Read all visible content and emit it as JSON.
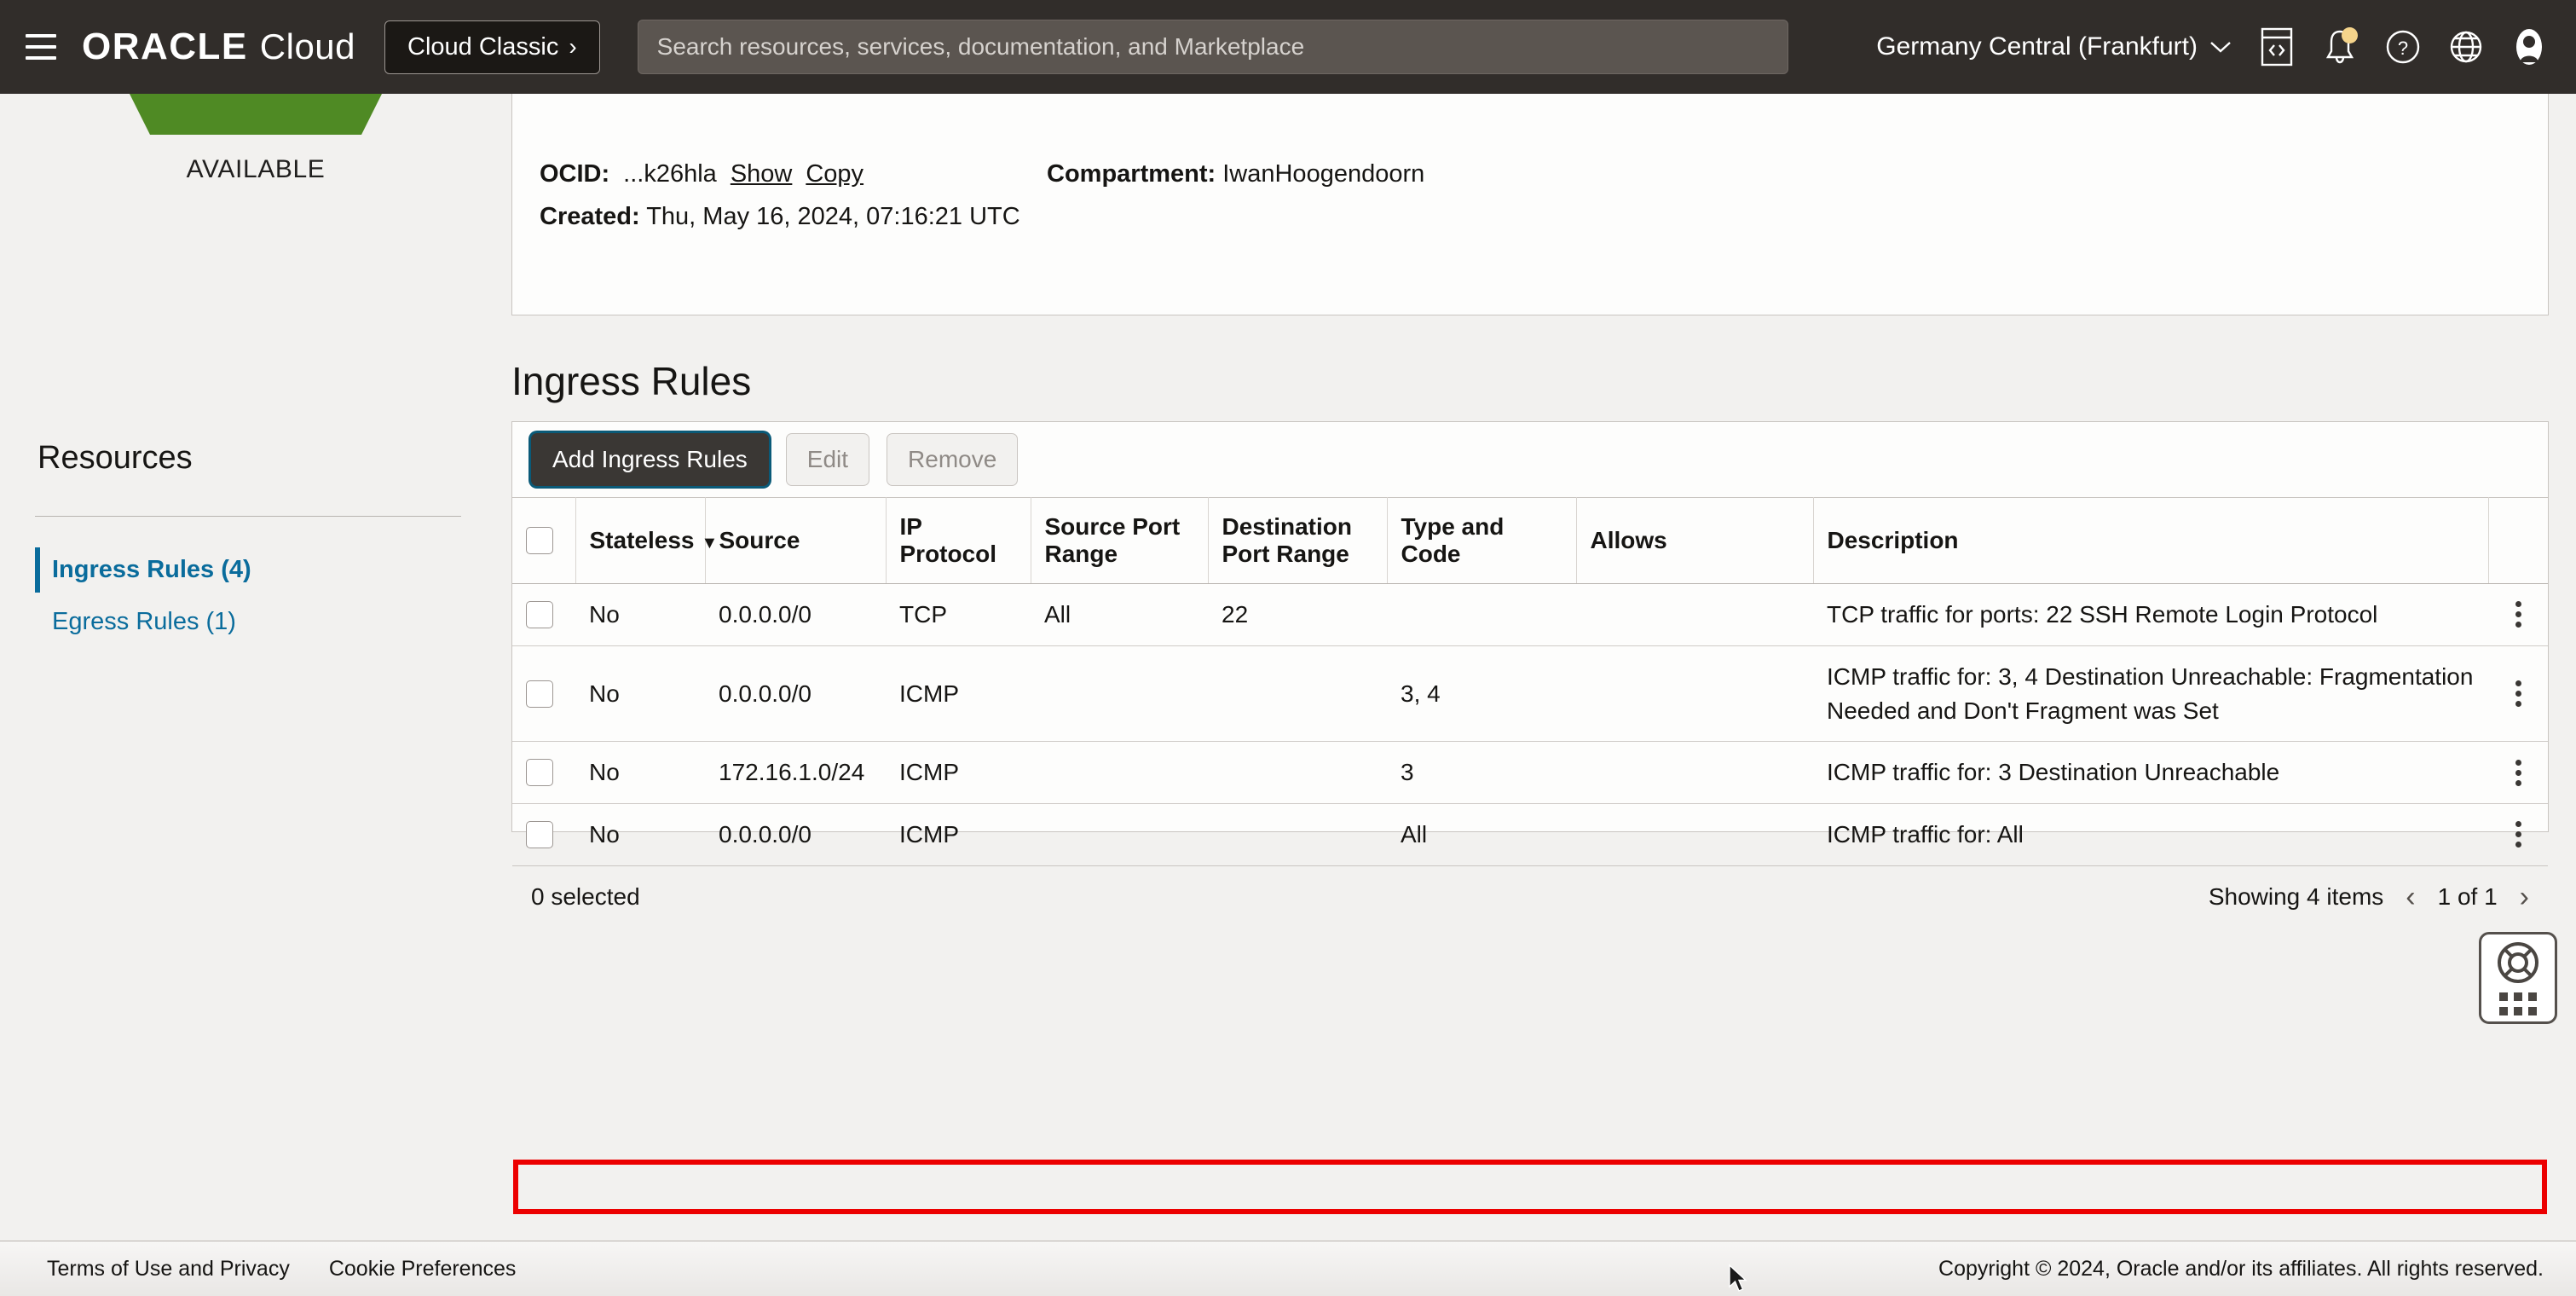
{
  "topnav": {
    "menu_icon": "hamburger-menu-icon",
    "brand_oracle": "ORACLE",
    "brand_cloud": "Cloud",
    "cloud_classic_label": "Cloud Classic",
    "cloud_classic_chevron": "›",
    "search_placeholder": "Search resources, services, documentation, and Marketplace",
    "search_value": "",
    "region": "Germany Central (Frankfurt)",
    "region_chevron": "⌄",
    "icons": [
      "code-editor-icon",
      "notifications-bell-icon",
      "help-question-icon",
      "language-globe-icon",
      "user-avatar-icon"
    ]
  },
  "sidebar": {
    "status_label": "AVAILABLE",
    "status_color": "#4f8a24",
    "resources_title": "Resources",
    "items": [
      {
        "label": "Ingress Rules (4)",
        "active": true
      },
      {
        "label": "Egress Rules (1)",
        "active": false
      }
    ]
  },
  "detail": {
    "ocid_label": "OCID:",
    "ocid_value": "...k26hla",
    "show_link": "Show",
    "copy_link": "Copy",
    "created_label": "Created:",
    "created_value": "Thu, May 16, 2024, 07:16:21 UTC",
    "compartment_label": "Compartment:",
    "compartment_value": "IwanHoogendoorn"
  },
  "section": {
    "title": "Ingress Rules"
  },
  "toolbar": {
    "add_label": "Add Ingress Rules",
    "edit_label": "Edit",
    "remove_label": "Remove"
  },
  "table": {
    "columns": [
      "Stateless",
      "Source",
      "IP Protocol",
      "Source Port Range",
      "Destination Port Range",
      "Type and Code",
      "Allows",
      "Description"
    ],
    "sort_caret": "▼",
    "rows": [
      {
        "stateless": "No",
        "source": "0.0.0.0/0",
        "protocol": "TCP",
        "source_port_range": "All",
        "destination_port_range": "22",
        "type_and_code": "",
        "allows": "",
        "description": "TCP traffic for ports: 22 SSH Remote Login Protocol",
        "highlighted": false
      },
      {
        "stateless": "No",
        "source": "0.0.0.0/0",
        "protocol": "ICMP",
        "source_port_range": "",
        "destination_port_range": "",
        "type_and_code": "3, 4",
        "allows": "",
        "description": "ICMP traffic for: 3, 4 Destination Unreachable: Fragmentation Needed and Don't Fragment was Set",
        "highlighted": false
      },
      {
        "stateless": "No",
        "source": "172.16.1.0/24",
        "protocol": "ICMP",
        "source_port_range": "",
        "destination_port_range": "",
        "type_and_code": "3",
        "allows": "",
        "description": "ICMP traffic for: 3 Destination Unreachable",
        "highlighted": false
      },
      {
        "stateless": "No",
        "source": "0.0.0.0/0",
        "protocol": "ICMP",
        "source_port_range": "",
        "destination_port_range": "",
        "type_and_code": "All",
        "allows": "",
        "description": "ICMP traffic for: All",
        "highlighted": true
      }
    ],
    "footer": {
      "selected_text": "0 selected",
      "showing_text": "Showing 4 items",
      "prev_arrow": "‹",
      "page_info": "1 of 1",
      "next_arrow": "›"
    },
    "annotation_color": "#ec0000"
  },
  "help_widget": {
    "icon": "life-ring-icon",
    "handle": "grid-drag-handle-icon"
  },
  "pagefoot": {
    "terms": "Terms of Use and Privacy",
    "cookies": "Cookie Preferences",
    "copyright": "Copyright © 2024, Oracle and/or its affiliates. All rights reserved."
  }
}
